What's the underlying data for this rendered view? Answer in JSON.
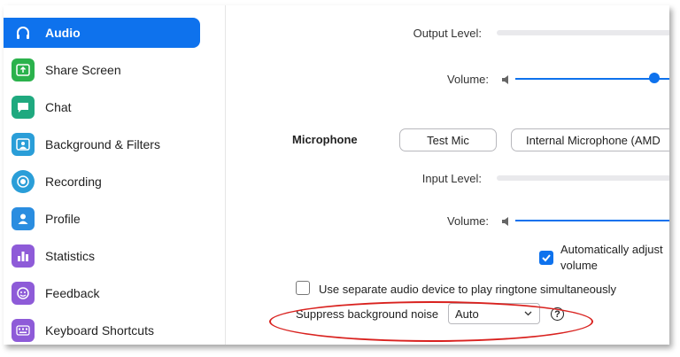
{
  "sidebar": {
    "items": [
      {
        "label": "Audio",
        "icon": "headphones-icon",
        "active": true
      },
      {
        "label": "Share Screen",
        "icon": "share-screen-icon",
        "color": "#2bb24c"
      },
      {
        "label": "Chat",
        "icon": "chat-icon",
        "color": "#1fa97f"
      },
      {
        "label": "Background & Filters",
        "icon": "background-icon",
        "color": "#2a9ed8"
      },
      {
        "label": "Recording",
        "icon": "recording-icon",
        "color": "#2a9ed8"
      },
      {
        "label": "Profile",
        "icon": "profile-icon",
        "color": "#2a8de0"
      },
      {
        "label": "Statistics",
        "icon": "statistics-icon",
        "color": "#8e5bd8"
      },
      {
        "label": "Feedback",
        "icon": "feedback-icon",
        "color": "#8e5bd8"
      },
      {
        "label": "Keyboard Shortcuts",
        "icon": "keyboard-icon",
        "color": "#8e5bd8"
      }
    ]
  },
  "speaker": {
    "output_level_label": "Output Level:",
    "volume_label": "Volume:",
    "volume_fraction": 0.87
  },
  "microphone": {
    "section_label": "Microphone",
    "test_button": "Test Mic",
    "device_select": "Internal Microphone (AMD",
    "input_level_label": "Input Level:",
    "volume_label": "Volume:",
    "auto_adjust_label_line1": "Automatically adjust",
    "auto_adjust_label_line2": "volume",
    "auto_adjust_checked": true
  },
  "ringtone": {
    "label": "Use separate audio device to play ringtone simultaneously",
    "checked": false
  },
  "noise": {
    "label": "Suppress background noise",
    "value": "Auto",
    "help": "?"
  },
  "colors": {
    "accent": "#0e72ed",
    "highlight": "#d9221f"
  }
}
